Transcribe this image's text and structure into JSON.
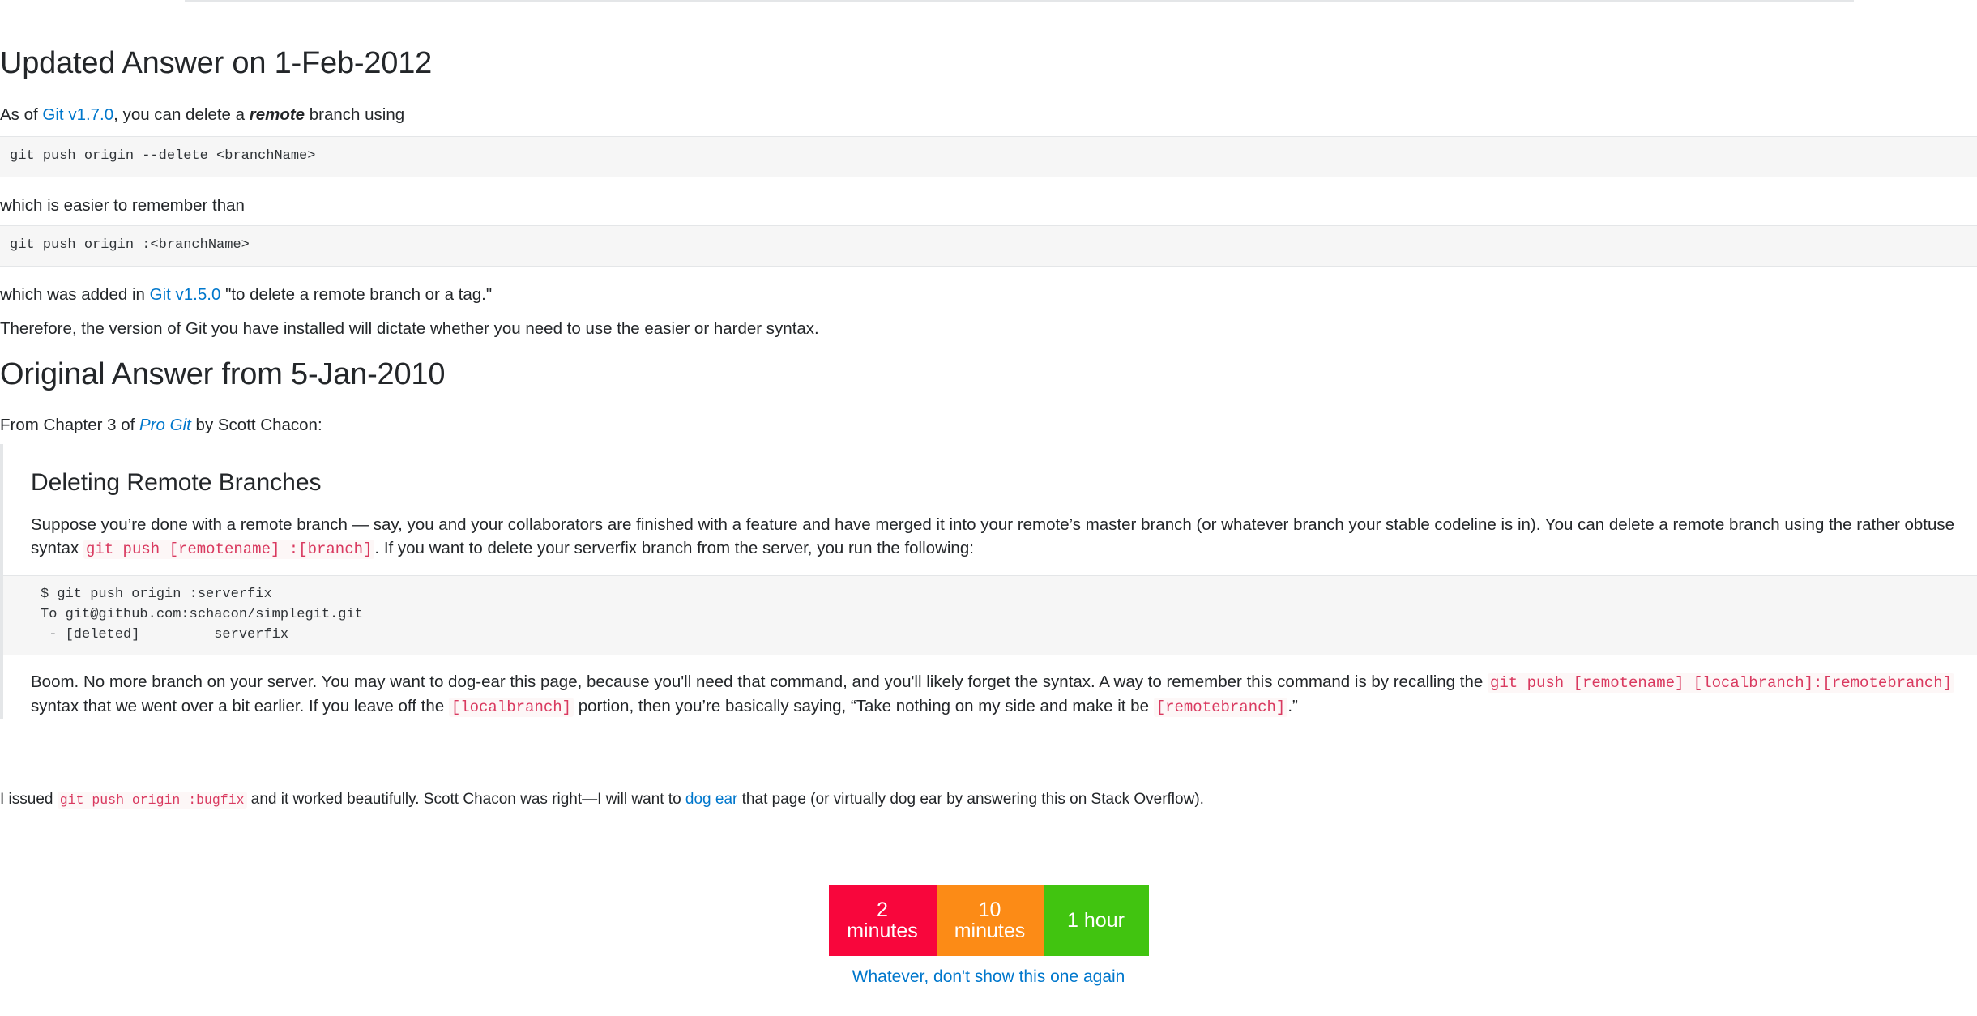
{
  "sections": {
    "updated": {
      "heading": "Updated Answer on 1-Feb-2012",
      "intro_before_link": "As of ",
      "intro_link": "Git v1.7.0",
      "intro_mid": ", you can delete a ",
      "intro_emphasis": "remote",
      "intro_after": " branch using",
      "code_easy": "git push origin --delete <branchName>",
      "which_easier": "which is easier to remember than",
      "code_hard": "git push origin :<branchName>",
      "added_before_link": "which was added in ",
      "added_link": "Git v1.5.0",
      "added_after": " \"to delete a remote branch or a tag.\"",
      "therefore": "Therefore, the version of Git you have installed will dictate whether you need to use the easier or harder syntax."
    },
    "original": {
      "heading": "Original Answer from 5-Jan-2010",
      "from_before": "From Chapter 3 of ",
      "from_link": "Pro Git",
      "from_after": " by Scott Chacon:"
    },
    "blockquote": {
      "heading": "Deleting Remote Branches",
      "p1_part1": "Suppose you’re done with a remote branch — say, you and your collaborators are finished with a feature and have merged it into your remote’s master branch (or whatever branch your stable codeline is in). You can delete a remote branch using the rather obtuse syntax ",
      "p1_code": "git push [remotename] :[branch]",
      "p1_part2": ". If you want to delete your serverfix branch from the server, you run the following:",
      "code": "$ git push origin :serverfix\nTo git@github.com:schacon/simplegit.git\n - [deleted]         serverfix",
      "p2_part1": "Boom. No more branch on your server. You may want to dog-ear this page, because you'll need that command, and you'll likely forget the syntax. A way to remember this command is by recalling the ",
      "p2_code1": "git push [remotename] [localbranch]:[remotebranch]",
      "p2_part2": " syntax that we went over a bit earlier. If you leave off the ",
      "p2_code2": "[localbranch]",
      "p2_part3": " portion, then you’re basically saying, “Take nothing on my side and make it be ",
      "p2_code3": "[remotebranch]",
      "p2_part4": ".”"
    },
    "closing": {
      "part1": "I issued ",
      "code": "git push origin :bugfix",
      "part2": " and it worked beautifully. Scott Chacon was right—I will want to ",
      "link": "dog ear",
      "part3": " that page (or virtually dog ear by answering this on Stack Overflow)."
    }
  },
  "survey": {
    "options": [
      {
        "value": "2",
        "unit": "minutes",
        "color": "#f8063c"
      },
      {
        "value": "10",
        "unit": "minutes",
        "color": "#fc8b16"
      },
      {
        "value": "1 hour",
        "unit": "",
        "color": "#41c410"
      }
    ],
    "dismiss_label": "Whatever, don't show this one again"
  },
  "colors": {
    "link": "#0077cc",
    "code_text": "#d9395f",
    "code_bg": "#fdf7f7",
    "pre_bg": "#f6f6f6",
    "border": "#e4e6e8"
  }
}
